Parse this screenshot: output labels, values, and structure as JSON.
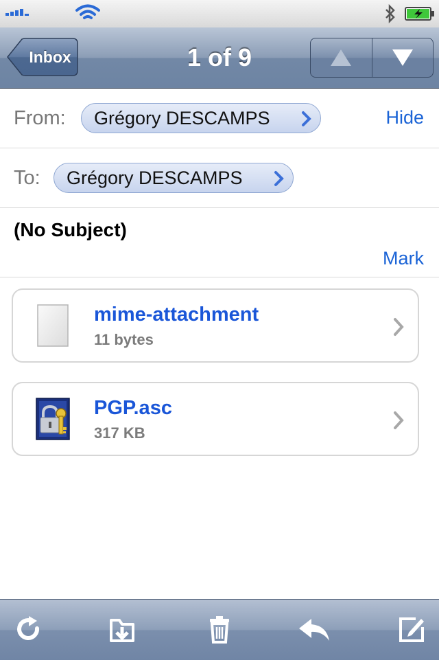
{
  "nav": {
    "back_label": "Inbox",
    "title": "1 of 9"
  },
  "header": {
    "from_label": "From:",
    "from_name": "Grégory DESCAMPS",
    "to_label": "To:",
    "to_name": "Grégory DESCAMPS",
    "hide_label": "Hide",
    "subject": "(No Subject)",
    "mark_label": "Mark"
  },
  "attachments": [
    {
      "name": "mime-attachment",
      "size": "11 bytes",
      "icon": "blank-document-icon"
    },
    {
      "name": "PGP.asc",
      "size": "317 KB",
      "icon": "pgp-key-lock-icon"
    }
  ],
  "toolbar": {
    "buttons": [
      "refresh-icon",
      "move-to-folder-icon",
      "trash-icon",
      "reply-icon",
      "compose-icon"
    ]
  },
  "colors": {
    "accent_link": "#1a63d6",
    "nav_bar": "#7288a6",
    "chip_fill": "#d5def3"
  }
}
